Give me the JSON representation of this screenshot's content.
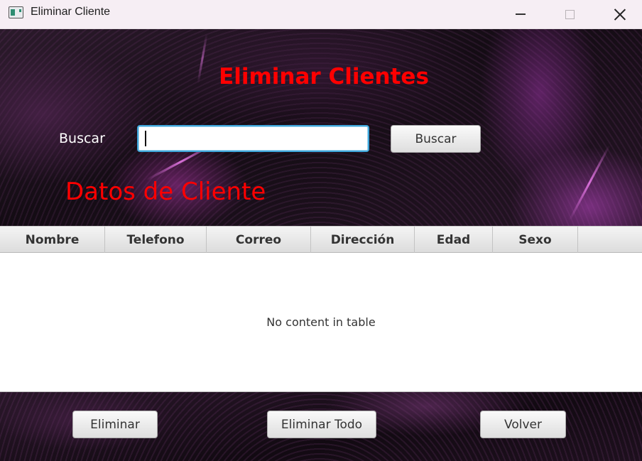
{
  "window": {
    "title": "Eliminar Cliente",
    "icon": "app-window-icon",
    "controls": [
      "minimize-icon",
      "maximize-icon",
      "close-icon"
    ]
  },
  "header": {
    "title": "Eliminar Clientes",
    "title_color": "#ff0000"
  },
  "search": {
    "label": "Buscar",
    "value": "",
    "button_label": "Buscar"
  },
  "section": {
    "title": "Datos de Cliente",
    "color": "#ff0000"
  },
  "table": {
    "columns": [
      "Nombre",
      "Telefono",
      "Correo",
      "Dirección",
      "Edad",
      "Sexo",
      ""
    ],
    "rows": [],
    "empty_message": "No content in table"
  },
  "actions": {
    "delete_label": "Eliminar",
    "delete_all_label": "Eliminar Todo",
    "back_label": "Volver"
  }
}
